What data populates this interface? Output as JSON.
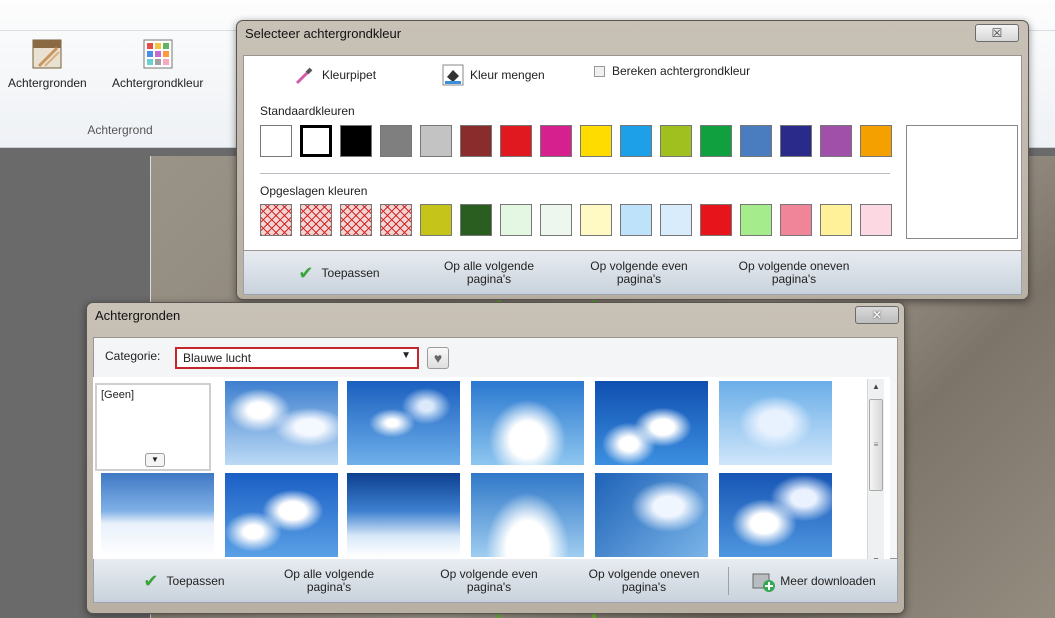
{
  "ribbon": {
    "btn_backgrounds": "Achtergronden",
    "btn_bgcolor": "Achtergrondkleur",
    "group_label": "Achtergrond"
  },
  "color_dialog": {
    "title": "Selecteer achtergrondkleur",
    "close": "☒",
    "eyedropper": "Kleurpipet",
    "mix": "Kleur mengen",
    "compute": "Bereken achtergrondkleur",
    "standard_label": "Standaardkleuren",
    "saved_label": "Opgeslagen kleuren",
    "standard_colors": [
      "#ffffff",
      "#ffffff",
      "#000000",
      "#7f7f7f",
      "#c3c3c3",
      "#8b2c2c",
      "#e0181f",
      "#d6208e",
      "#ffdc00",
      "#1ea0e8",
      "#a0c020",
      "#10a040",
      "#4a7cc0",
      "#2a2a8a",
      "#a050a8",
      "#f4a000"
    ],
    "saved_colors": [
      "hatch",
      "hatch",
      "hatch",
      "hatch",
      "#c4c41a",
      "#2a5e20",
      "#e3f7e3",
      "#eef7ee",
      "#fff9c4",
      "#bfe2fb",
      "#d8ecfb",
      "#e8141c",
      "#a5ec8c",
      "#f08498",
      "#fff199",
      "#fbd8e2"
    ],
    "footer": {
      "apply": "Toepassen",
      "all_next": "Op alle volgende pagina's",
      "next_even": "Op volgende even pagina's",
      "next_odd": "Op volgende oneven pagina's"
    }
  },
  "bg_dialog": {
    "title": "Achtergronden",
    "close": "✕",
    "category_label": "Categorie:",
    "category_value": "Blauwe lucht",
    "none_label": "[Geen]",
    "thumbs": [
      "sky-1",
      "sky-2",
      "sky-3",
      "sky-4",
      "sky-5",
      "sky-6",
      "sky-7",
      "sky-8",
      "sky-9",
      "sky-10",
      "sky-11"
    ],
    "footer": {
      "apply": "Toepassen",
      "all_next": "Op alle volgende pagina's",
      "next_even": "Op volgende even pagina's",
      "next_odd": "Op volgende oneven pagina's",
      "download": "Meer downloaden"
    }
  }
}
